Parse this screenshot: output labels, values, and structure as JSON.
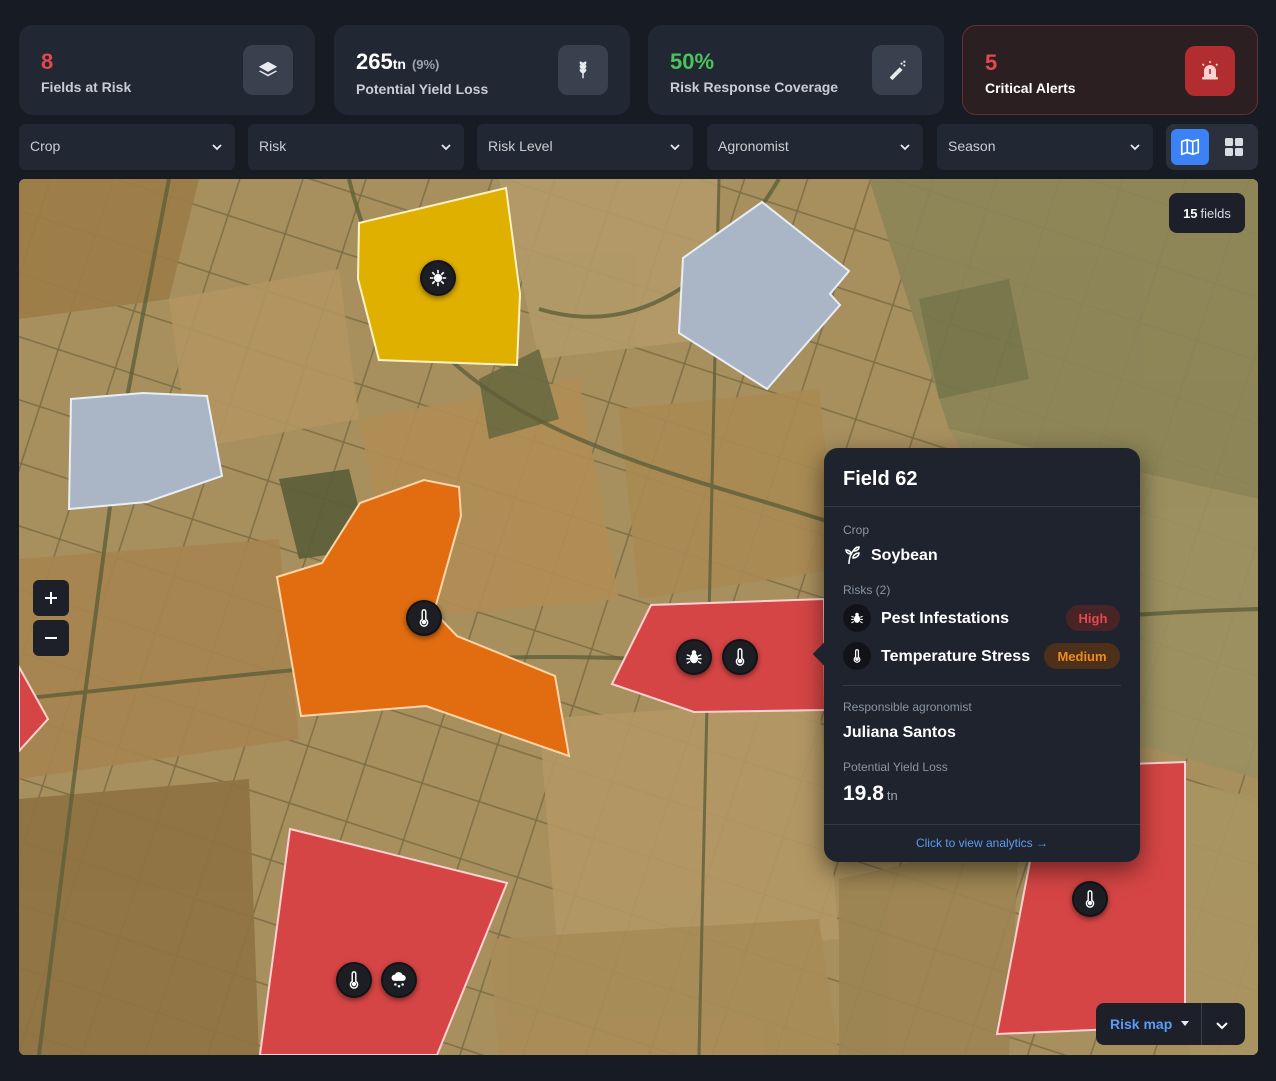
{
  "kpis": {
    "fields_at_risk": {
      "value": "8",
      "label": "Fields at Risk",
      "icon": "layers-icon"
    },
    "yield_loss": {
      "value": "265",
      "unit": "tn",
      "percent": "(9%)",
      "label": "Potential Yield Loss",
      "icon": "wheat-icon"
    },
    "coverage": {
      "value": "50%",
      "label": "Risk Response Coverage",
      "icon": "spray-icon"
    },
    "critical_alerts": {
      "value": "5",
      "label": "Critical Alerts",
      "icon": "alarm-icon"
    }
  },
  "filters": {
    "crop": "Crop",
    "risk": "Risk",
    "risk_level": "Risk Level",
    "agronomist": "Agronomist",
    "season": "Season"
  },
  "view_toggle": {
    "active": "map",
    "options": [
      "map",
      "grid"
    ]
  },
  "map": {
    "field_count_num": "15",
    "field_count_label": "fields",
    "layer_selector": "Risk map"
  },
  "popup": {
    "title": "Field 62",
    "crop_label": "Crop",
    "crop_value": "Soybean",
    "risks_label": "Risks (2)",
    "risks": [
      {
        "name": "Pest Infestations",
        "level": "High",
        "icon": "bug-icon"
      },
      {
        "name": "Temperature Stress",
        "level": "Medium",
        "icon": "thermometer-icon"
      }
    ],
    "agronomist_label": "Responsible agronomist",
    "agronomist_value": "Juliana Santos",
    "yield_label": "Potential Yield Loss",
    "yield_value": "19.8",
    "yield_unit": "tn",
    "link": "Click to view analytics →"
  },
  "colors": {
    "background": "#161b24",
    "card": "#222833",
    "accent_blue": "#3b82f6",
    "risk_high": "#d64545",
    "risk_medium": "#e26d10",
    "risk_low": "#e0b000",
    "no_risk": "#aab6c6",
    "value_red": "#e5484d",
    "value_green": "#4ec25a"
  }
}
